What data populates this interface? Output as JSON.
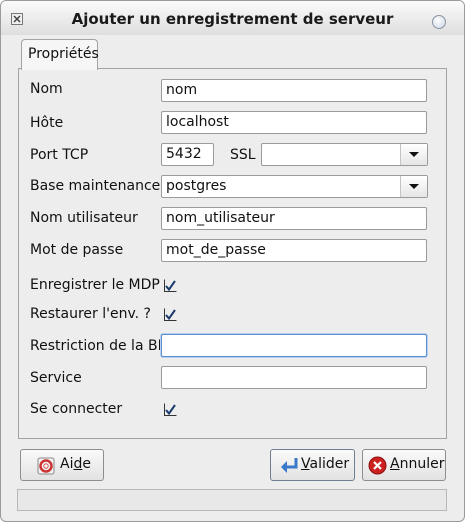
{
  "window": {
    "title": "Ajouter un enregistrement de serveur"
  },
  "tabs": [
    {
      "label": "Propriétés",
      "active": true
    }
  ],
  "form": {
    "name": {
      "label": "Nom",
      "value": "nom"
    },
    "host": {
      "label": "Hôte",
      "value": "localhost"
    },
    "port": {
      "label": "Port TCP",
      "value": "5432"
    },
    "ssl": {
      "label": "SSL",
      "value": ""
    },
    "maintenance_db": {
      "label": "Base maintenance",
      "value": "postgres"
    },
    "username": {
      "label": "Nom utilisateur",
      "value": "nom_utilisateur"
    },
    "password": {
      "label": "Mot de passe",
      "value": "mot_de_passe"
    },
    "save_password": {
      "label": "Enregistrer le MDP",
      "checked": true
    },
    "restore_env": {
      "label": "Restaurer l'env. ?",
      "checked": true
    },
    "db_restriction": {
      "label": "Restriction de la BD",
      "value": ""
    },
    "service": {
      "label": "Service",
      "value": ""
    },
    "connect": {
      "label": "Se connecter",
      "checked": true
    }
  },
  "buttons": {
    "help": {
      "label_pre": "Ai",
      "label_mnemonic": "d",
      "label_post": "e",
      "icon": "lifebuoy-icon"
    },
    "ok": {
      "label_pre": "",
      "label_mnemonic": "V",
      "label_post": "alider",
      "icon": "enter-arrow-icon"
    },
    "cancel": {
      "label_pre": "",
      "label_mnemonic": "A",
      "label_post": "nnuler",
      "icon": "cancel-icon"
    }
  },
  "statusbar": {
    "text": ""
  },
  "colors": {
    "focus_border": "#5b8fd0",
    "check_mark": "#1a3a6e",
    "cancel_red": "#cc1f1f",
    "ok_arrow_blue": "#3a78c9"
  }
}
